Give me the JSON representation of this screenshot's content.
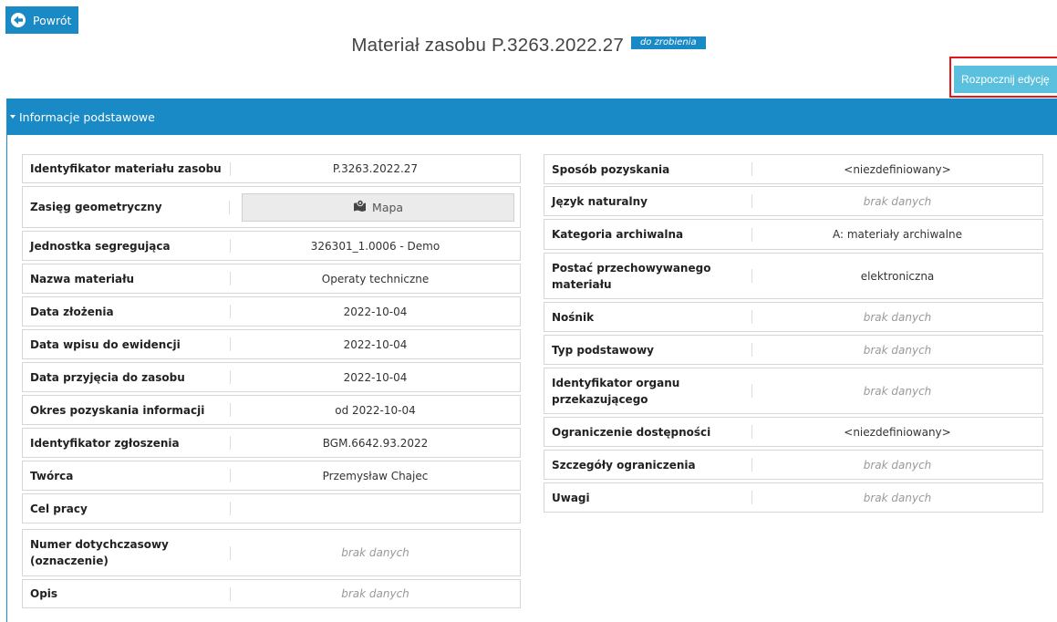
{
  "nav": {
    "back_label": "Powrót"
  },
  "header": {
    "title": "Materiał zasobu P.3263.2022.27",
    "status": "do zrobienia"
  },
  "actions": {
    "edit_label": "Rozpocznij edycję"
  },
  "panel": {
    "title": "Informacje podstawowe"
  },
  "map_button": {
    "label": "Mapa",
    "icon": "map-marker-icon"
  },
  "left_rows": [
    {
      "label": "Identyfikator materiału zasobu",
      "value": "P.3263.2022.27"
    },
    {
      "label": "Zasięg geometryczny",
      "value": ""
    },
    {
      "label": "Jednostka segregująca",
      "value": "326301_1.0006 - Demo"
    },
    {
      "label": "Nazwa materiału",
      "value": "Operaty techniczne"
    },
    {
      "label": "Data złożenia",
      "value": "2022-10-04"
    },
    {
      "label": "Data wpisu do ewidencji",
      "value": "2022-10-04"
    },
    {
      "label": "Data przyjęcia do zasobu",
      "value": "2022-10-04"
    },
    {
      "label": "Okres pozyskania informacji",
      "value": "od 2022-10-04"
    },
    {
      "label": "Identyfikator zgłoszenia",
      "value": "BGM.6642.93.2022"
    },
    {
      "label": "Twórca",
      "value": "Przemysław Chajec"
    },
    {
      "label": "Cel pracy",
      "value": ""
    },
    {
      "label": "Numer dotychczasowy (oznaczenie)",
      "value": "brak danych"
    },
    {
      "label": "Opis",
      "value": "brak danych"
    }
  ],
  "right_rows": [
    {
      "label": "Sposób pozyskania",
      "value": "<niezdefiniowany>"
    },
    {
      "label": "Język naturalny",
      "value": "brak danych"
    },
    {
      "label": "Kategoria archiwalna",
      "value": "A: materiały archiwalne"
    },
    {
      "label": "Postać przechowywanego materiału",
      "value": "elektroniczna"
    },
    {
      "label": "Nośnik",
      "value": "brak danych"
    },
    {
      "label": "Typ podstawowy",
      "value": "brak danych"
    },
    {
      "label": "Identyfikator organu przekazującego",
      "value": "brak danych"
    },
    {
      "label": "Ograniczenie dostępności",
      "value": "<niezdefiniowany>"
    },
    {
      "label": "Szczegóły ograniczenia",
      "value": "brak danych"
    },
    {
      "label": "Uwagi",
      "value": "brak danych"
    }
  ],
  "empty_value_text": "brak danych"
}
